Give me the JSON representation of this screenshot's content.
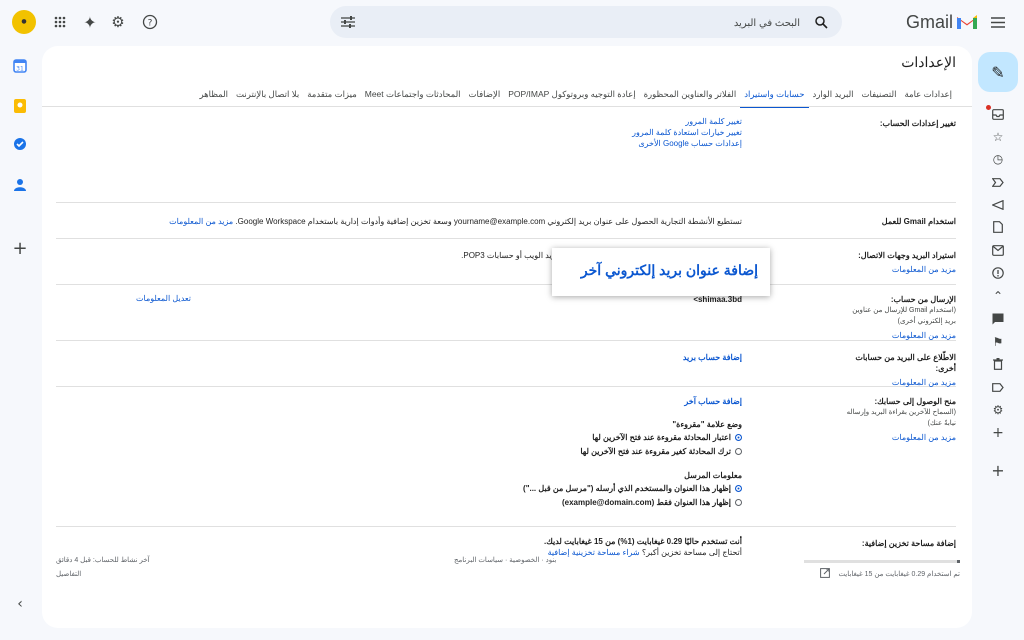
{
  "app": {
    "name": "Gmail"
  },
  "search": {
    "placeholder": "البحث في البريد"
  },
  "settings": {
    "title": "الإعدادات",
    "tabs": [
      {
        "label": "إعدادات عامة"
      },
      {
        "label": "التصنيفات"
      },
      {
        "label": "البريد الوارد"
      },
      {
        "label": "حسابات واستيراد",
        "active": true
      },
      {
        "label": "الفلاتر والعناوين المحظورة"
      },
      {
        "label": "إعادة التوجيه وبروتوكول POP/IMAP"
      },
      {
        "label": "الإضافات"
      },
      {
        "label": "المحادثات واجتماعات Meet"
      },
      {
        "label": "ميزات متقدمة"
      },
      {
        "label": "بلا اتصال بالإنترنت"
      },
      {
        "label": "المظاهر"
      }
    ],
    "change_account": {
      "label": "تغيير إعدادات الحساب:",
      "links": [
        "تغيير كلمة المرور",
        "تغيير خيارات استعادة كلمة المرور",
        "إعدادات حساب Google الأخرى"
      ]
    },
    "gmail_work": {
      "label": "استخدام Gmail للعمل",
      "text": "تستطيع الأنشطة التجارية الحصول على عنوان بريد إلكتروني yourname@example.com وسعة تخزين إضافية وأدوات إدارية باستخدام Google Workspace.",
      "link": "مزيد من المعلومات"
    },
    "import": {
      "label": "استيراد البريد وجهات الاتصال:",
      "learn_more": "مزيد من المعلومات",
      "text": "الاستيراد من Yahoo! أو Hotmail أو AOL أو غير ذلك من بريد الويب أو حسابات POP3.",
      "action": "استيراد البريد وجهات الاتصال"
    },
    "send_as": {
      "label": "الإرسال من حساب:",
      "sub": "(استخدام Gmail للإرسال من عناوين بريد إلكتروني أخرى)",
      "learn_more": "مزيد من المعلومات",
      "address": "<shimaa.3bd",
      "edit": "تعديل المعلومات"
    },
    "check_mail": {
      "label": "الاطّلاع على البريد من حسابات أخرى:",
      "learn_more": "مزيد من المعلومات",
      "action": "إضافة حساب بريد"
    },
    "grant_access": {
      "label": "منح الوصول إلى حسابك:",
      "sub": "(السماح للآخرين بقراءة البريد وإرساله نيابةً عنك)",
      "learn_more": "مزيد من المعلومات",
      "action": "إضافة حساب آخر",
      "mark_read_title": "وضع علامة \"مقروءة\"",
      "mark_read_options": [
        {
          "label": "اعتبار المحادثة مقروءة عند فتح الآخرين لها",
          "selected": true
        },
        {
          "label": "ترك المحادثة كغير مقروءة عند فتح الآخرين لها",
          "selected": false
        }
      ],
      "sender_title": "معلومات المرسل",
      "sender_options": [
        {
          "label": "إظهار هذا العنوان والمستخدم الذي أرسله (\"مرسل من قبل ...\")",
          "selected": true
        },
        {
          "label": "إظهار هذا العنوان فقط (example@domain.com)",
          "selected": false
        }
      ]
    },
    "storage": {
      "label": "إضافة مساحة تخزين إضافية:",
      "text": "أنت تستخدم حاليًا 0.29 غيغابايت (1%) من 15 غيغابايت لديك.",
      "need_more": "أتحتاج إلى مساحة تخزين أكبر؟",
      "link": "شراء مساحة تخزينية إضافية"
    }
  },
  "tooltip": {
    "text": "إضافة عنوان بريد إلكتروني آخر"
  },
  "footer": {
    "usage": "تم استخدام 0.29 غيغابايت من 15 غيغابايت",
    "usage_fraction": 0.02,
    "terms": "بنود · الخصوصية · سياسات البرنامج",
    "activity": "آخر نشاط للحساب: قبل 4 دقائق",
    "details": "التفاصيل"
  },
  "colors": {
    "accent": "#0b57d0",
    "background": "#f6f8fc",
    "compose": "#c2e7ff"
  },
  "icons": [
    "menu-icon",
    "search-icon",
    "tune-icon",
    "help-icon",
    "gear-icon",
    "gemini-icon",
    "apps-icon",
    "pencil-icon"
  ]
}
